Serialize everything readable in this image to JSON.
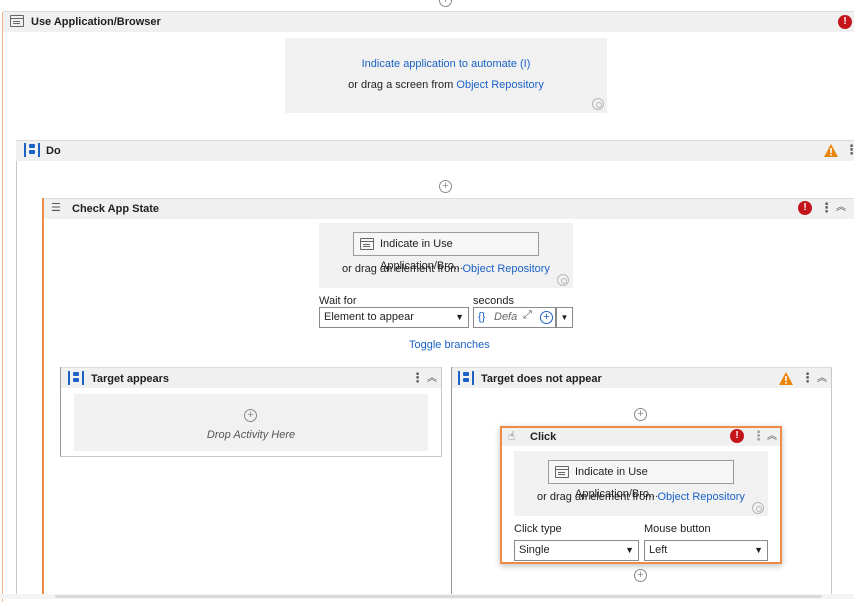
{
  "use_app": {
    "title": "Use Application/Browser",
    "indicate_link": "Indicate application to automate (I)",
    "drag_prefix": "or drag a screen from",
    "drag_link": "Object Repository"
  },
  "do": {
    "title": "Do"
  },
  "check_app_state": {
    "title": "Check App State",
    "indicate_button": "Indicate in Use Application/Bro...",
    "drag_prefix": "or drag an element from",
    "drag_link": "Object Repository",
    "wait_for_label": "Wait for",
    "wait_for_value": "Element to appear",
    "seconds_label": "seconds",
    "seconds_placeholder": "Defa",
    "seconds_brace": "{}",
    "toggle_branches": "Toggle branches"
  },
  "target_appears": {
    "title": "Target appears",
    "drop_text": "Drop Activity Here"
  },
  "target_not_appear": {
    "title": "Target does not appear"
  },
  "click": {
    "title": "Click",
    "indicate_button": "Indicate in Use Application/Bro...",
    "drag_prefix": "or drag an element from",
    "drag_link": "Object Repository",
    "click_type_label": "Click type",
    "click_type_value": "Single",
    "mouse_button_label": "Mouse button",
    "mouse_button_value": "Left"
  },
  "colors": {
    "accent_orange": "#f08a49",
    "link_blue": "#1a62c7",
    "error_red": "#c4141c",
    "warning_orange": "#e8860c"
  }
}
